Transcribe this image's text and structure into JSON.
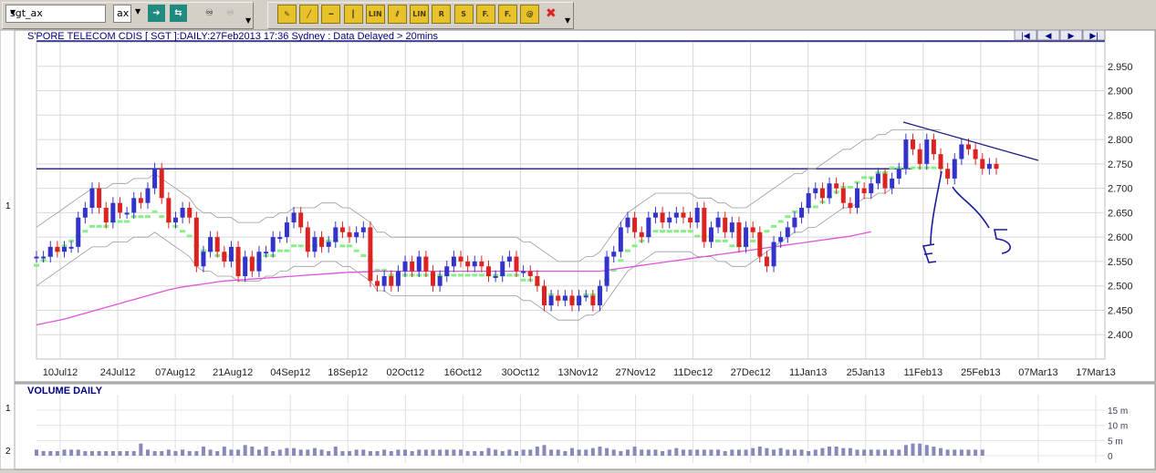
{
  "toolbar": {
    "symbol": "sgt_ax",
    "exchange": "ax",
    "buttons": [
      {
        "name": "go-arrow-icon",
        "glyph": "➔",
        "bg": "#1f8b7f",
        "fg": "#ffffff"
      },
      {
        "name": "refresh-arrows-icon",
        "glyph": "⇆",
        "bg": "#1f8b7f",
        "fg": "#ffffff"
      },
      {
        "name": "binoculars-icon",
        "glyph": "♾",
        "bg": "#d4d0c8",
        "fg": "#000000"
      },
      {
        "name": "binoculars-disabled-icon",
        "glyph": "♾",
        "bg": "#d4d0c8",
        "fg": "#9a9a9a"
      }
    ],
    "tools": [
      {
        "name": "pencil-tool-icon",
        "glyph": "✎"
      },
      {
        "name": "trendline-tool-icon",
        "glyph": "╱"
      },
      {
        "name": "horizontal-line-tool-icon",
        "glyph": "━"
      },
      {
        "name": "vertical-line-tool-icon",
        "glyph": "┃"
      },
      {
        "name": "lin-tool-icon",
        "glyph": "LIN"
      },
      {
        "name": "parallel-lines-tool-icon",
        "glyph": "⫽"
      },
      {
        "name": "lin-channel-tool-icon",
        "glyph": "LIN"
      },
      {
        "name": "r-tool-icon",
        "glyph": "R"
      },
      {
        "name": "s-tool-icon",
        "glyph": "S"
      },
      {
        "name": "fib-retracement-tool-icon",
        "glyph": "F."
      },
      {
        "name": "fib-extension-tool-icon",
        "glyph": "F."
      },
      {
        "name": "text-tool-icon",
        "glyph": "@"
      },
      {
        "name": "delete-tool-icon",
        "glyph": "✖"
      }
    ]
  },
  "colors": {
    "up": "#3333cc",
    "down": "#dd2222",
    "ma_short": "#9a9a9a",
    "ma_long": "#dd55dd",
    "band": "#88ee88",
    "vol": "#8888bb",
    "line": "#1a1a80"
  },
  "nav": [
    {
      "name": "nav-first-icon",
      "glyph": "|◀"
    },
    {
      "name": "nav-prev-icon",
      "glyph": "◀"
    },
    {
      "name": "nav-next-icon",
      "glyph": "▶"
    },
    {
      "name": "nav-last-icon",
      "glyph": "▶|"
    }
  ],
  "chart_data": [
    {
      "type": "candlestick",
      "title": "S'PORE TELECOM CDIS [ SGT ]:DAILY:27Feb2013 17:36 Sydney : Data Delayed > 20mins",
      "ylim": [
        2.35,
        3.0
      ],
      "yticks": [
        "2.400",
        "2.450",
        "2.500",
        "2.550",
        "2.600",
        "2.650",
        "2.700",
        "2.750",
        "2.800",
        "2.850",
        "2.900",
        "2.950"
      ],
      "xticks": [
        "10Jul12",
        "24Jul12",
        "07Aug12",
        "21Aug12",
        "04Sep12",
        "18Sep12",
        "02Oct12",
        "16Oct12",
        "30Oct12",
        "13Nov12",
        "27Nov12",
        "11Dec12",
        "27Dec12",
        "11Jan13",
        "25Jan13",
        "11Feb13",
        "25Feb13",
        "07Mar13",
        "17Mar13"
      ],
      "left_marker": "1",
      "horizontal_line": 2.74,
      "close": [
        2.56,
        2.56,
        2.58,
        2.57,
        2.58,
        2.58,
        2.64,
        2.66,
        2.7,
        2.66,
        2.63,
        2.67,
        2.65,
        2.65,
        2.68,
        2.67,
        2.7,
        2.74,
        2.68,
        2.63,
        2.64,
        2.66,
        2.64,
        2.54,
        2.57,
        2.6,
        2.57,
        2.55,
        2.58,
        2.52,
        2.56,
        2.53,
        2.57,
        2.57,
        2.6,
        2.6,
        2.63,
        2.65,
        2.62,
        2.57,
        2.6,
        2.58,
        2.59,
        2.62,
        2.61,
        2.6,
        2.61,
        2.62,
        2.51,
        2.5,
        2.52,
        2.5,
        2.53,
        2.55,
        2.53,
        2.56,
        2.53,
        2.5,
        2.52,
        2.54,
        2.56,
        2.55,
        2.54,
        2.55,
        2.54,
        2.52,
        2.52,
        2.55,
        2.56,
        2.53,
        2.53,
        2.52,
        2.5,
        2.46,
        2.48,
        2.47,
        2.48,
        2.46,
        2.48,
        2.48,
        2.46,
        2.5,
        2.56,
        2.57,
        2.62,
        2.64,
        2.61,
        2.6,
        2.64,
        2.65,
        2.63,
        2.64,
        2.65,
        2.64,
        2.63,
        2.66,
        2.59,
        2.62,
        2.64,
        2.61,
        2.63,
        2.58,
        2.62,
        2.61,
        2.56,
        2.54,
        2.59,
        2.6,
        2.62,
        2.64,
        2.66,
        2.69,
        2.7,
        2.68,
        2.71,
        2.7,
        2.67,
        2.66,
        2.7,
        2.69,
        2.71,
        2.73,
        2.7,
        2.72,
        2.74,
        2.8,
        2.78,
        2.75,
        2.8,
        2.77,
        2.74,
        2.72,
        2.76,
        2.79,
        2.78,
        2.76,
        2.74,
        2.75,
        2.74
      ],
      "ma_short": [
        2.56,
        2.57,
        2.58,
        2.59,
        2.6,
        2.61,
        2.62,
        2.63,
        2.64,
        2.64,
        2.64,
        2.65,
        2.65,
        2.65,
        2.66,
        2.66,
        2.66,
        2.67,
        2.66,
        2.65,
        2.64,
        2.63,
        2.62,
        2.6,
        2.59,
        2.59,
        2.58,
        2.58,
        2.58,
        2.57,
        2.57,
        2.57,
        2.57,
        2.58,
        2.58,
        2.59,
        2.59,
        2.6,
        2.6,
        2.6,
        2.6,
        2.61,
        2.61,
        2.61,
        2.6,
        2.6,
        2.59,
        2.58,
        2.57,
        2.55,
        2.55,
        2.54,
        2.54,
        2.54,
        2.54,
        2.54,
        2.54,
        2.54,
        2.54,
        2.54,
        2.54,
        2.54,
        2.54,
        2.54,
        2.54,
        2.54,
        2.54,
        2.54,
        2.54,
        2.54,
        2.53,
        2.53,
        2.52,
        2.51,
        2.5,
        2.49,
        2.49,
        2.49,
        2.49,
        2.5,
        2.5,
        2.51,
        2.53,
        2.55,
        2.57,
        2.59,
        2.6,
        2.61,
        2.62,
        2.63,
        2.63,
        2.63,
        2.63,
        2.63,
        2.63,
        2.62,
        2.62,
        2.62,
        2.61,
        2.61,
        2.6,
        2.6,
        2.6,
        2.61,
        2.62,
        2.63,
        2.64,
        2.65,
        2.66,
        2.67,
        2.67,
        2.68,
        2.68,
        2.69,
        2.7,
        2.71,
        2.72,
        2.72,
        2.73,
        2.74,
        2.74,
        2.75,
        2.75,
        2.76,
        2.76,
        2.76,
        2.76,
        2.76,
        2.76,
        2.76,
        2.76
      ],
      "ma_long": [
        2.42,
        2.423,
        2.426,
        2.429,
        2.432,
        2.436,
        2.44,
        2.444,
        2.448,
        2.452,
        2.456,
        2.46,
        2.464,
        2.468,
        2.472,
        2.476,
        2.48,
        2.484,
        2.488,
        2.492,
        2.495,
        2.498,
        2.5,
        2.502,
        2.504,
        2.506,
        2.508,
        2.51,
        2.511,
        2.512,
        2.513,
        2.514,
        2.515,
        2.516,
        2.517,
        2.518,
        2.519,
        2.52,
        2.521,
        2.522,
        2.523,
        2.524,
        2.525,
        2.526,
        2.527,
        2.528,
        2.528,
        2.529,
        2.529,
        2.53,
        2.53,
        2.53,
        2.53,
        2.53,
        2.53,
        2.53,
        2.53,
        2.53,
        2.53,
        2.53,
        2.53,
        2.53,
        2.53,
        2.53,
        2.53,
        2.53,
        2.53,
        2.53,
        2.53,
        2.53,
        2.53,
        2.53,
        2.53,
        2.53,
        2.53,
        2.53,
        2.53,
        2.53,
        2.53,
        2.53,
        2.53,
        2.53,
        2.532,
        2.534,
        2.536,
        2.538,
        2.54,
        2.542,
        2.544,
        2.546,
        2.548,
        2.55,
        2.552,
        2.554,
        2.556,
        2.558,
        2.56,
        2.562,
        2.564,
        2.566,
        2.568,
        2.57,
        2.572,
        2.574,
        2.576,
        2.578,
        2.58,
        2.582,
        2.584,
        2.586,
        2.588,
        2.59,
        2.592,
        2.594,
        2.596,
        2.598,
        2.6,
        2.602,
        2.605,
        2.608,
        2.611
      ]
    },
    {
      "type": "bar",
      "title": "VOLUME DAILY",
      "left_markers": [
        "1",
        "2"
      ],
      "yticks": [
        "15 m",
        "10 m",
        "5 m",
        "0"
      ],
      "ylim": [
        0,
        18
      ],
      "values": [
        2,
        1.5,
        1.5,
        1.5,
        2,
        2,
        2,
        1.5,
        1.5,
        1.5,
        1.5,
        1.5,
        1.5,
        1.5,
        1.5,
        4,
        2,
        1.5,
        1.5,
        2,
        1.5,
        2,
        1.5,
        1.5,
        3,
        2,
        1.5,
        3,
        2,
        2,
        3.5,
        3,
        2,
        3,
        1.5,
        2,
        2.5,
        2.5,
        2,
        2,
        2.5,
        2,
        1.5,
        3,
        1.5,
        1.5,
        2,
        2,
        1.5,
        1.5,
        2,
        1.5,
        2,
        2,
        1.5,
        2,
        2,
        2,
        2,
        2,
        2,
        2,
        1.5,
        1.5,
        1.5,
        2.5,
        2,
        1.5,
        2,
        1.5,
        2,
        2,
        3,
        3.5,
        2,
        2,
        1.5,
        2.5,
        2,
        2,
        2.5,
        3,
        2.5,
        2,
        1.5,
        2,
        3,
        2,
        2,
        2,
        1.5,
        2,
        2.5,
        2,
        2,
        2,
        2,
        2,
        2,
        1.5,
        2,
        2,
        2,
        2.5,
        3,
        2.5,
        2,
        2.5,
        2,
        2,
        2,
        1.5,
        2,
        2.5,
        3,
        3,
        2.5,
        2.5,
        2,
        2,
        2,
        2,
        2,
        2,
        2,
        3.5,
        4,
        4,
        3.5,
        3,
        2.5,
        2,
        2,
        2,
        2,
        2,
        2
      ]
    }
  ]
}
